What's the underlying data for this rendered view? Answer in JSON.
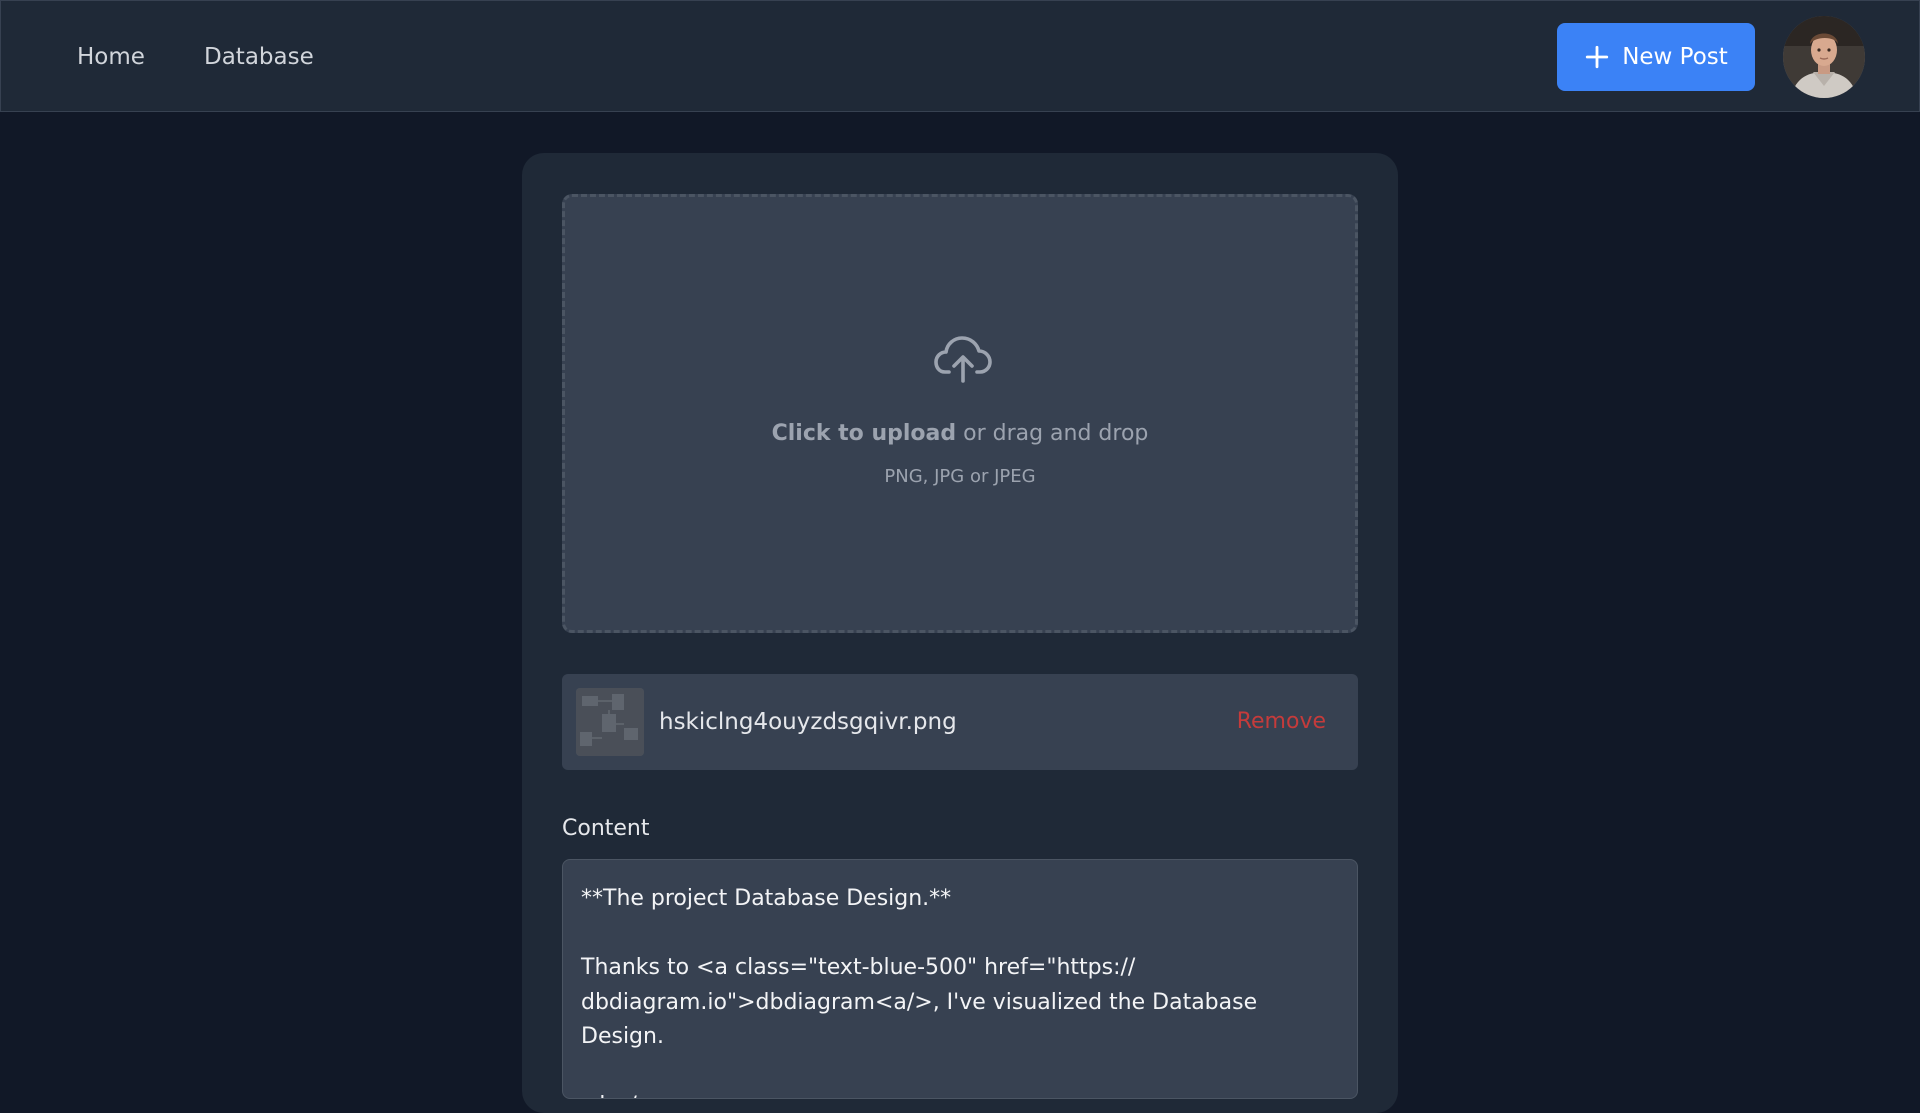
{
  "nav": {
    "links": [
      {
        "label": "Home"
      },
      {
        "label": "Database"
      }
    ],
    "new_post_label": "New Post",
    "accent_color": "#3b82f6"
  },
  "upload": {
    "icon": "cloud-upload-icon",
    "cta_bold": "Click to upload",
    "cta_rest": " or drag and drop",
    "hint": "PNG, JPG or JPEG"
  },
  "file": {
    "name": "hskiclng4ouyzdsgqivr.png",
    "remove_label": "Remove",
    "remove_color": "#c53b3b"
  },
  "content": {
    "label": "Content",
    "value": "**The project Database Design.**\n\nThanks to <a class=\"text-blue-500\" href=\"https://\ndbdiagram.io\">dbdiagram<a/>, I've visualized the Database Design.\n\n<br />"
  }
}
